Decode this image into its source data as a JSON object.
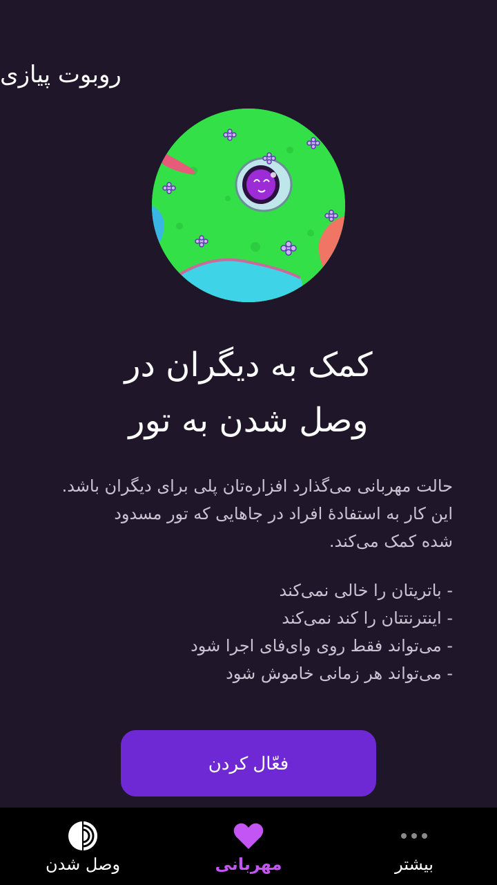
{
  "header": {
    "app_title": "روبوت پیازی"
  },
  "hero": {
    "illustration": "onion-robot-in-meadow"
  },
  "main": {
    "headline_line1": "کمک به دیگران در",
    "headline_line2": "وصل شدن به تور",
    "description_line1": "حالت مهربانی می‌گذارد افزاره‌تان پلی برای دیگران باشد.",
    "description_line2": "این کار به استفادهٔ افراد در جاهایی که تور مسدود",
    "description_line3": "شده کمک می‌کند.",
    "bullets": [
      "- باتریتان را خالی نمی‌کند",
      "- اینترنتتان را کند نمی‌کند",
      "- می‌تواند فقط روی وای‌فای اجرا شود",
      "- می‌تواند هر زمانی خاموش شود"
    ],
    "activate_label": "فعّال کردن"
  },
  "nav": {
    "connect_label": "وصل شدن",
    "kindness_label": "مهربانی",
    "more_label": "بیشتر"
  },
  "colors": {
    "background": "#1f1729",
    "accent_button": "#6e28d4",
    "active_nav": "#c455f5",
    "meadow": "#35e24a"
  }
}
